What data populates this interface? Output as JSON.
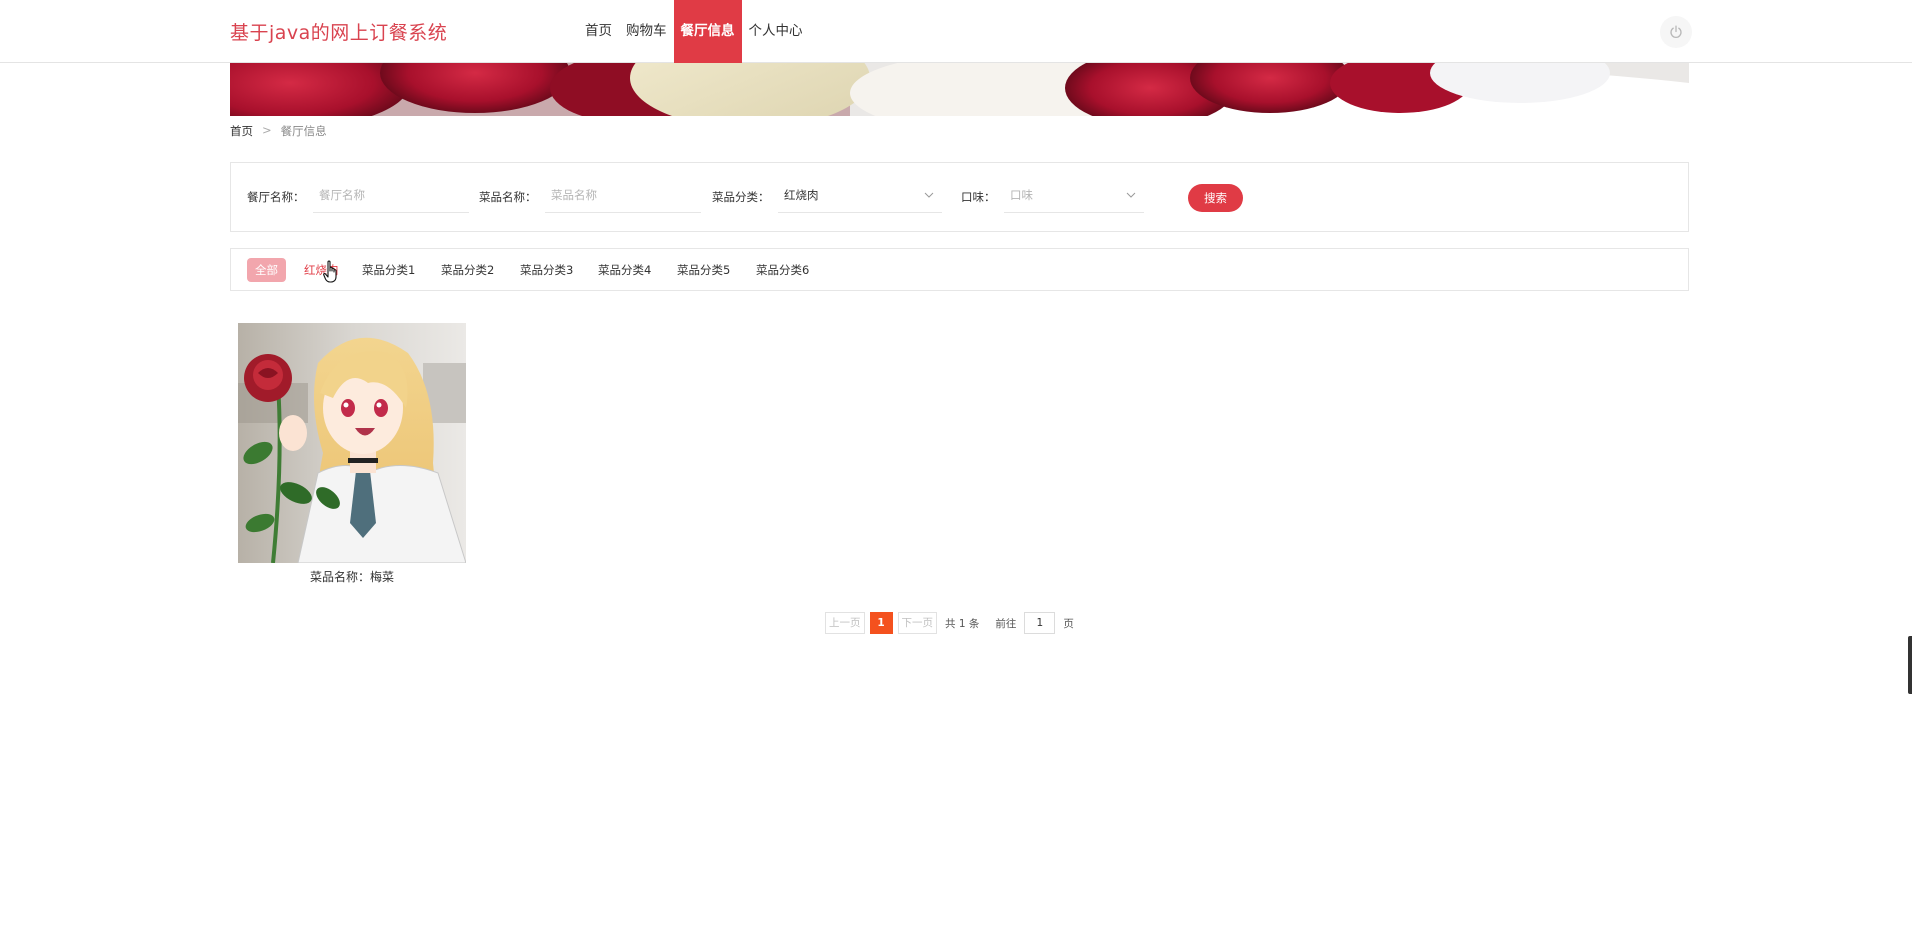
{
  "header": {
    "logo": "基于java的网上订餐系统",
    "nav": [
      {
        "label": "首页",
        "active": false
      },
      {
        "label": "购物车",
        "active": false
      },
      {
        "label": "餐厅信息",
        "active": true
      },
      {
        "label": "个人中心",
        "active": false
      }
    ],
    "power_icon": "power-icon"
  },
  "breadcrumb": {
    "home": "首页",
    "separator": ">",
    "current": "餐厅信息"
  },
  "search": {
    "restaurant_label": "餐厅名称：",
    "restaurant_placeholder": "餐厅名称",
    "dish_label": "菜品名称：",
    "dish_placeholder": "菜品名称",
    "category_label": "菜品分类：",
    "category_value": "红烧肉",
    "taste_label": "口味：",
    "taste_placeholder": "口味",
    "button": "搜索"
  },
  "categories": {
    "all": "全部",
    "items": [
      "红烧肉",
      "菜品分类1",
      "菜品分类2",
      "菜品分类3",
      "菜品分类4",
      "菜品分类5",
      "菜品分类6"
    ]
  },
  "products": [
    {
      "name": "菜品名称：梅菜"
    }
  ],
  "pagination": {
    "prev": "上一页",
    "current_page": "1",
    "next": "下一页",
    "total": "共 1 条",
    "goto_label": "前往",
    "goto_value": "1",
    "page_suffix": "页"
  },
  "colors": {
    "accent": "#e03b45",
    "logo": "#d9434f",
    "page_active": "#f4511e",
    "all_badge": "#f2a6ad"
  }
}
